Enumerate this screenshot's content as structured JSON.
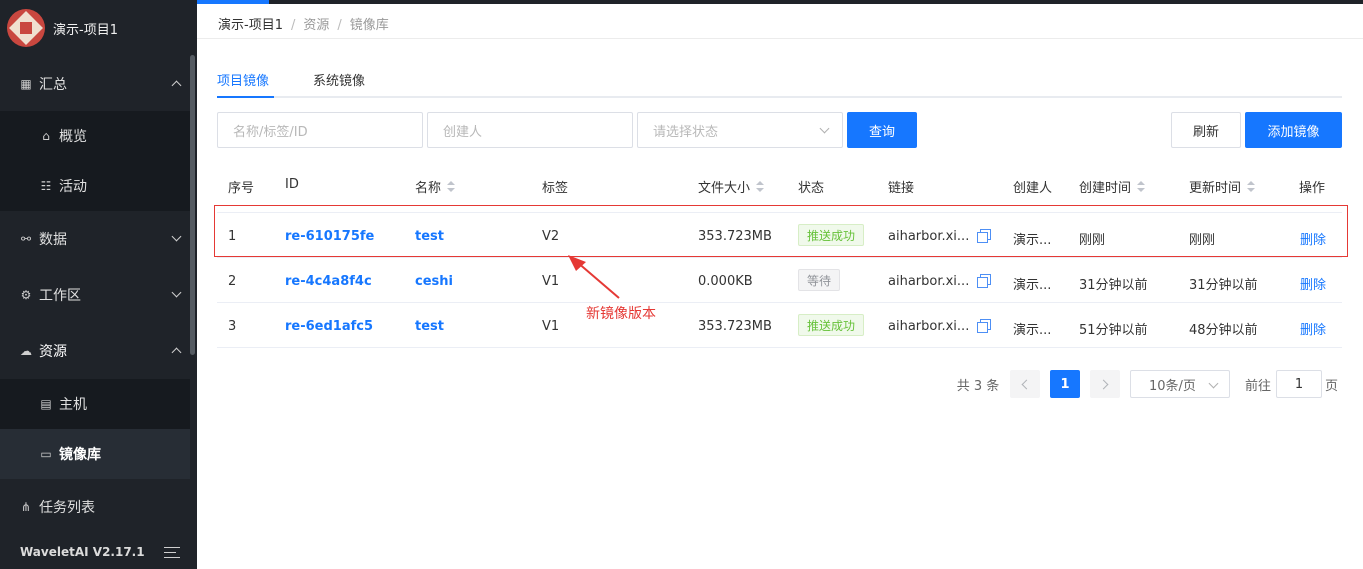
{
  "sidebar": {
    "app_name": "演示-项目1",
    "items": [
      {
        "label": "汇总",
        "icon": "grid-icon",
        "expanded": true
      },
      {
        "label": "概览",
        "icon": "home-icon"
      },
      {
        "label": "活动",
        "icon": "activity-icon"
      },
      {
        "label": "数据",
        "icon": "hierarchy-icon",
        "expanded": false
      },
      {
        "label": "工作区",
        "icon": "gear-icon",
        "expanded": false
      },
      {
        "label": "资源",
        "icon": "cloud-icon",
        "expanded": true
      },
      {
        "label": "主机",
        "icon": "server-icon"
      },
      {
        "label": "镜像库",
        "icon": "image-repo-icon",
        "active": true
      },
      {
        "label": "任务列表",
        "icon": "share-icon"
      }
    ],
    "version": "WaveletAI V2.17.1"
  },
  "breadcrumb": [
    "演示-项目1",
    "资源",
    "镜像库"
  ],
  "tabs": [
    {
      "label": "项目镜像",
      "active": true
    },
    {
      "label": "系统镜像",
      "active": false
    }
  ],
  "filters": {
    "name_placeholder": "名称/标签/ID",
    "creator_placeholder": "创建人",
    "status_placeholder": "请选择状态",
    "query_label": "查询",
    "refresh_label": "刷新",
    "add_label": "添加镜像"
  },
  "table": {
    "headers": [
      "序号",
      "ID",
      "名称",
      "标签",
      "文件大小",
      "状态",
      "链接",
      "创建人",
      "创建时间",
      "更新时间",
      "操作"
    ],
    "rows": [
      {
        "no": "1",
        "id": "re-610175fe",
        "name": "test",
        "tag": "V2",
        "size": "353.723MB",
        "status": "推送成功",
        "status_type": "success",
        "link": "aiharbor.xi...",
        "creator": "演示...",
        "created": "刚刚",
        "updated": "刚刚",
        "op": "删除"
      },
      {
        "no": "2",
        "id": "re-4c4a8f4c",
        "name": "ceshi",
        "tag": "V1",
        "size": "0.000KB",
        "status": "等待",
        "status_type": "waiting",
        "link": "aiharbor.xi...",
        "creator": "演示...",
        "created": "31分钟以前",
        "updated": "31分钟以前",
        "op": "删除"
      },
      {
        "no": "3",
        "id": "re-6ed1afc5",
        "name": "test",
        "tag": "V1",
        "size": "353.723MB",
        "status": "推送成功",
        "status_type": "success",
        "link": "aiharbor.xi...",
        "creator": "演示...",
        "created": "51分钟以前",
        "updated": "48分钟以前",
        "op": "删除"
      }
    ]
  },
  "annotation": "新镜像版本",
  "pagination": {
    "total": "共 3 条",
    "current": "1",
    "page_size": "10条/页",
    "goto_label": "前往",
    "goto_value": "1",
    "page_unit": "页"
  },
  "colors": {
    "primary": "#1677ff",
    "sidebar_bg": "#1f2329",
    "annotation": "#e53935",
    "success": "#67c23a"
  }
}
